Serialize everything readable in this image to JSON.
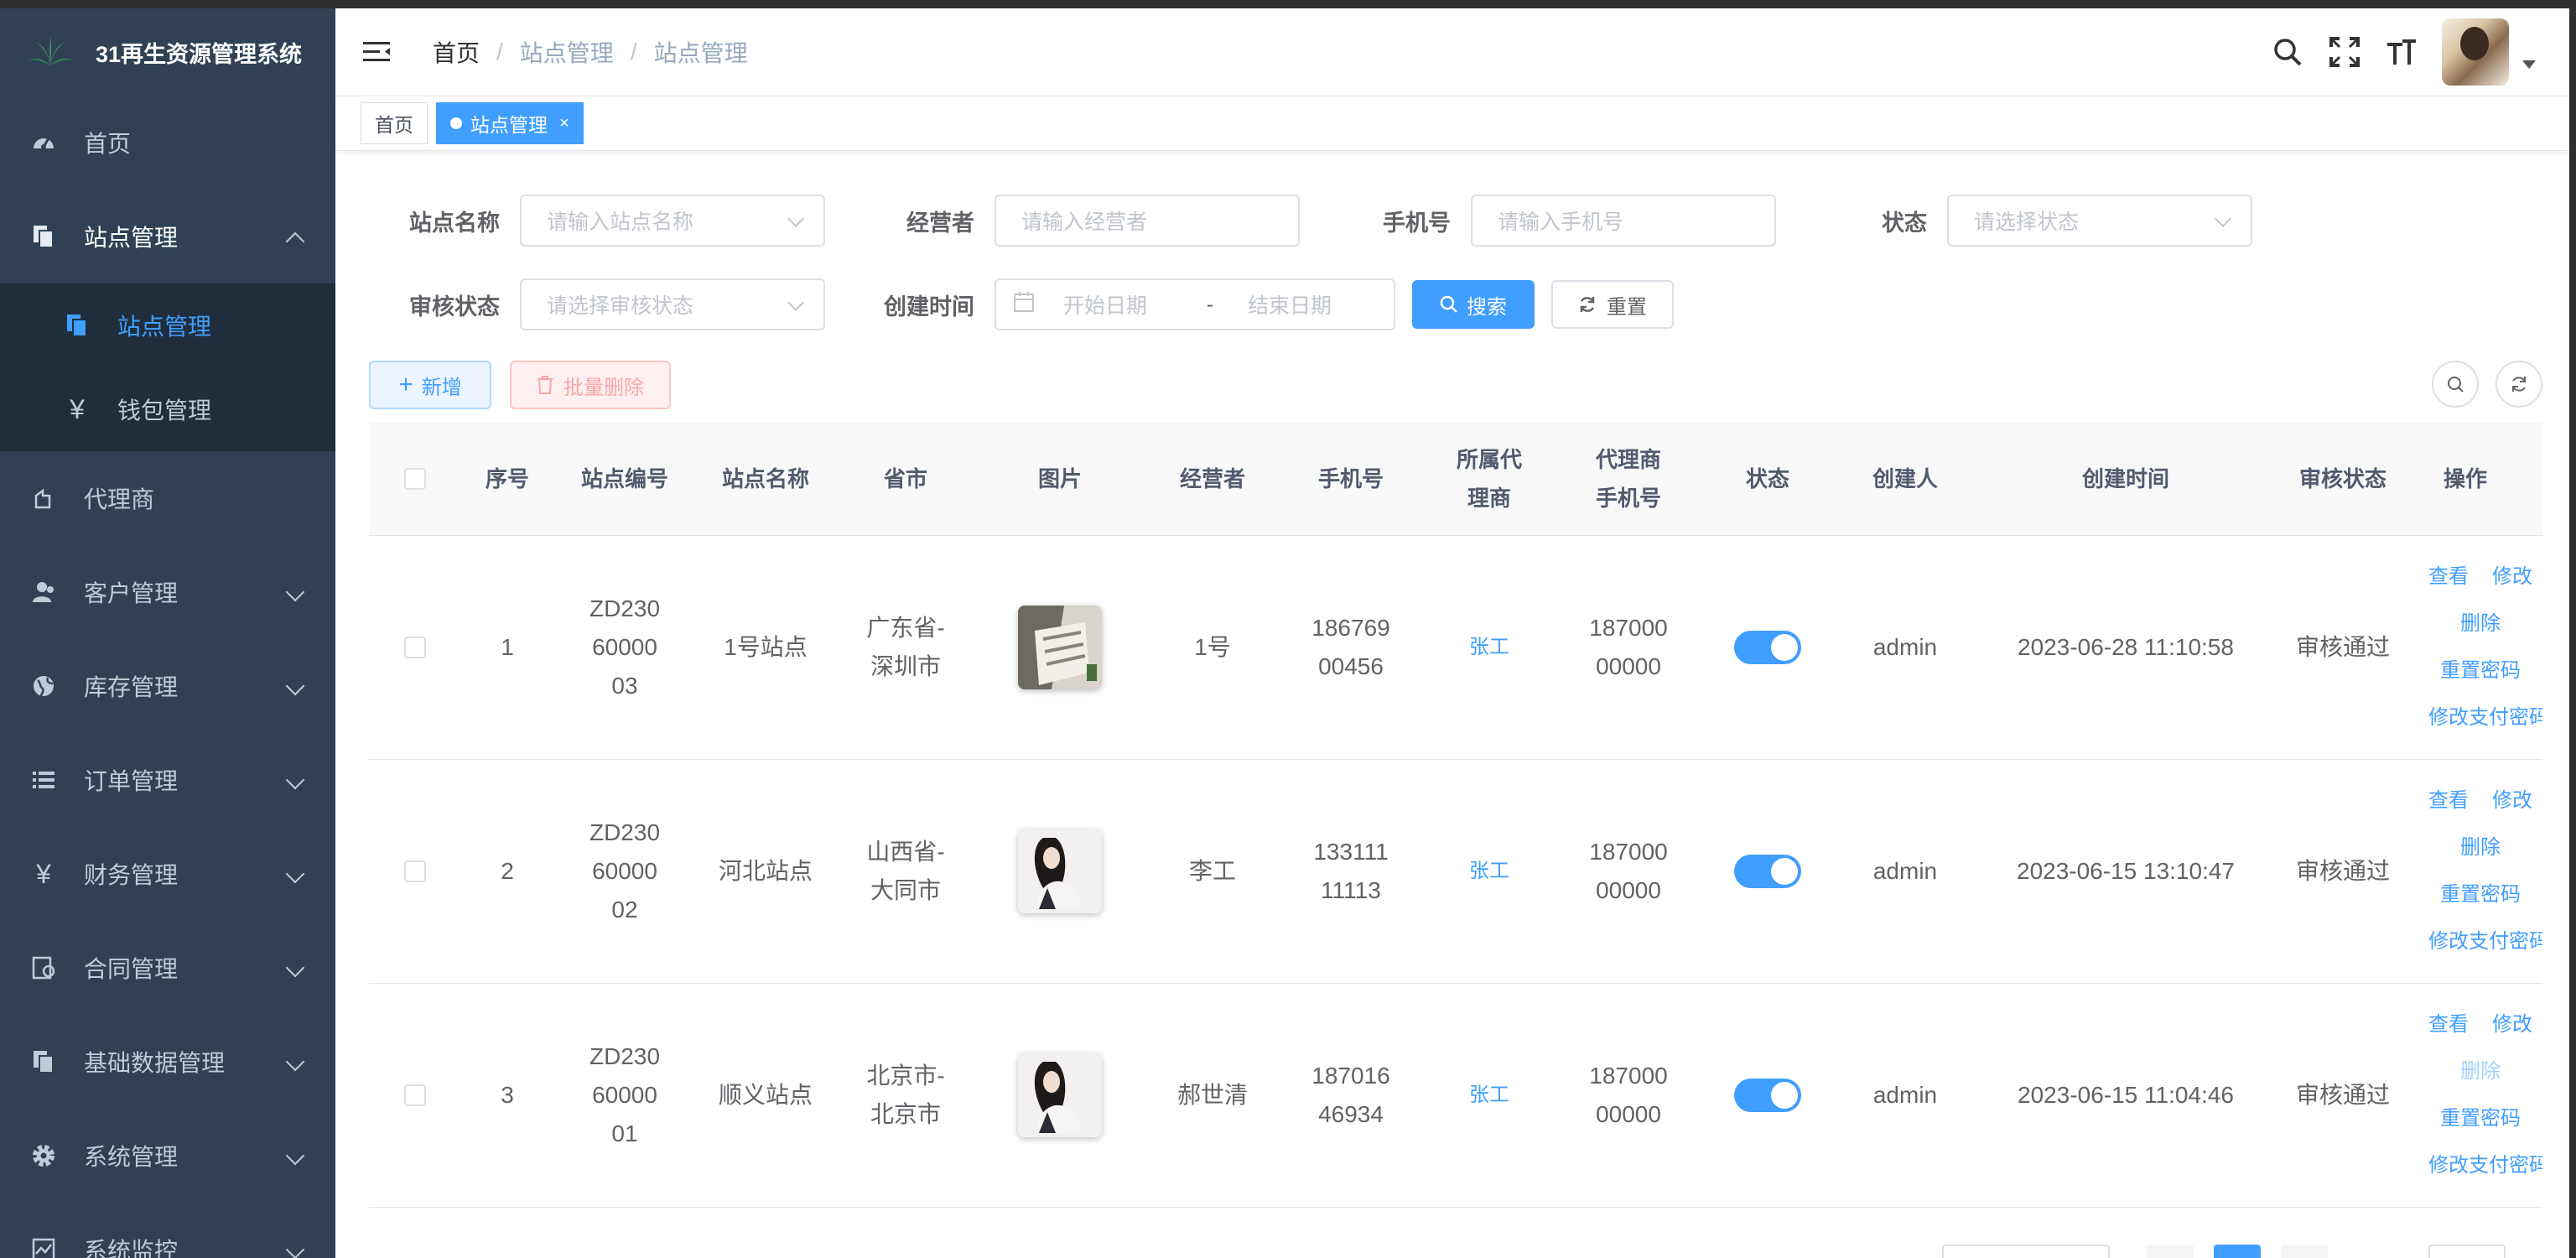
{
  "app": {
    "title": "31再生资源管理系统"
  },
  "sidebar": {
    "items": [
      {
        "label": "首页",
        "icon": "dashboard-icon"
      },
      {
        "label": "站点管理",
        "icon": "copy-icon",
        "expanded": true,
        "children": [
          {
            "label": "站点管理",
            "icon": "copy-icon",
            "active": true
          },
          {
            "label": "钱包管理",
            "icon": "yen-icon"
          }
        ]
      },
      {
        "label": "代理商",
        "icon": "agent-icon"
      },
      {
        "label": "客户管理",
        "icon": "user-icon"
      },
      {
        "label": "库存管理",
        "icon": "globe-icon"
      },
      {
        "label": "订单管理",
        "icon": "list-icon"
      },
      {
        "label": "财务管理",
        "icon": "yen-icon"
      },
      {
        "label": "合同管理",
        "icon": "contract-icon"
      },
      {
        "label": "基础数据管理",
        "icon": "copy-icon"
      },
      {
        "label": "系统管理",
        "icon": "gear-icon"
      },
      {
        "label": "系统监控",
        "icon": "monitor-icon"
      }
    ]
  },
  "breadcrumb": [
    "首页",
    "站点管理",
    "站点管理"
  ],
  "tags": [
    {
      "label": "首页",
      "active": false
    },
    {
      "label": "站点管理",
      "active": true,
      "close": "×"
    }
  ],
  "filters": {
    "site_name": {
      "label": "站点名称",
      "placeholder": "请输入站点名称"
    },
    "operator": {
      "label": "经营者",
      "placeholder": "请输入经营者"
    },
    "phone": {
      "label": "手机号",
      "placeholder": "请输入手机号"
    },
    "status": {
      "label": "状态",
      "placeholder": "请选择状态"
    },
    "audit_status": {
      "label": "审核状态",
      "placeholder": "请选择审核状态"
    },
    "created": {
      "label": "创建时间",
      "start": "开始日期",
      "sep": "-",
      "end": "结束日期"
    },
    "search_btn": "搜索",
    "reset_btn": "重置"
  },
  "toolbar": {
    "add_btn": "新增",
    "batch_delete_btn": "批量删除"
  },
  "table": {
    "headers": [
      "序号",
      "站点编号",
      "站点名称",
      "省市",
      "图片",
      "经营者",
      "手机号",
      "所属代理商",
      "代理商手机号",
      "状态",
      "创建人",
      "创建时间",
      "审核状态",
      "操作"
    ],
    "rows": [
      {
        "index": "1",
        "code": "ZD2306000003",
        "name": "1号站点",
        "region": "广东省- 深圳市",
        "operator": "1号",
        "phone": "18676900456",
        "agent": "张工",
        "agent_phone": "18700000000",
        "status": true,
        "creator": "admin",
        "created": "2023-06-28 11:10:58",
        "audit": "审核通过",
        "thumb": "stairs"
      },
      {
        "index": "2",
        "code": "ZD2306000002",
        "name": "河北站点",
        "region": "山西省- 大同市",
        "operator": "李工",
        "phone": "13311111113",
        "agent": "张工",
        "agent_phone": "18700000000",
        "status": true,
        "creator": "admin",
        "created": "2023-06-15 13:10:47",
        "audit": "审核通过",
        "thumb": "person"
      },
      {
        "index": "3",
        "code": "ZD2306000001",
        "name": "顺义站点",
        "region": "北京市-北京市",
        "operator": "郝世清",
        "phone": "18701646934",
        "agent": "张工",
        "agent_phone": "18700000000",
        "status": true,
        "creator": "admin",
        "created": "2023-06-15 11:04:46",
        "audit": "审核通过",
        "thumb": "person"
      }
    ],
    "ops": {
      "view": "查看",
      "edit": "修改",
      "delete": "删除",
      "reset_pwd": "重置密码",
      "edit_pay_pwd": "修改支付密码"
    }
  },
  "colors": {
    "primary": "#409eff",
    "sidebar_bg": "#304156",
    "submenu_bg": "#1f2d3d"
  }
}
